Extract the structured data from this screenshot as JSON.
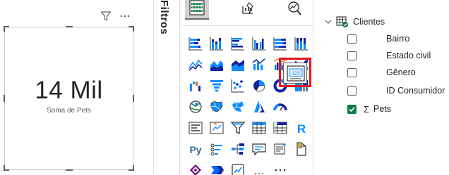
{
  "canvas": {
    "card": {
      "value": "14 Mil",
      "label": "Soma de Pets"
    }
  },
  "filters": {
    "label": "Filtros"
  },
  "visualizations": {
    "top_tabs": [
      {
        "name": "build-visual-icon",
        "active": true
      },
      {
        "name": "format-visual-icon",
        "active": false
      },
      {
        "name": "analytics-icon",
        "active": false
      }
    ],
    "selected_visual": "card-visual",
    "visual_icons": [
      "stacked-bar-chart",
      "stacked-column-chart",
      "clustered-bar-chart",
      "clustered-column-chart",
      "100-percent-stacked-bar-chart",
      "100-percent-stacked-column-chart",
      "line-chart",
      "area-chart",
      "stacked-area-chart",
      "line-and-stacked-column-chart",
      "line-and-clustered-column-chart",
      "ribbon-chart",
      "waterfall-chart",
      "funnel-chart",
      "scatter-chart",
      "pie-chart",
      "donut-chart",
      "treemap",
      "map",
      "filled-map",
      "shape-map",
      "azure-map",
      "gauge",
      "card-visual",
      "multi-row-card",
      "kpi",
      "slicer",
      "table",
      "matrix",
      "r-script-visual",
      "python-visual",
      "key-influencers",
      "decomposition-tree",
      "qa-visual",
      "smart-narrative",
      "paginated-report",
      "power-apps-visual",
      "power-automate-visual",
      "metrics-visual",
      "get-more-visuals",
      "more-options"
    ]
  },
  "fields": {
    "table": {
      "name": "Clientes"
    },
    "items": [
      {
        "name": "Bairro",
        "checked": false,
        "sigma": false
      },
      {
        "name": "Estado civil",
        "checked": false,
        "sigma": false
      },
      {
        "name": "Gênero",
        "checked": false,
        "sigma": false
      },
      {
        "name": "ID Consumidor",
        "checked": false,
        "sigma": false
      },
      {
        "name": "Pets",
        "checked": true,
        "sigma": true,
        "sigma_symbol": "Σ"
      }
    ]
  },
  "colors": {
    "accent_green": "#107c41",
    "highlight_red": "#e8131b",
    "chart_blue": "#118dff",
    "chart_navy": "#12239e"
  }
}
